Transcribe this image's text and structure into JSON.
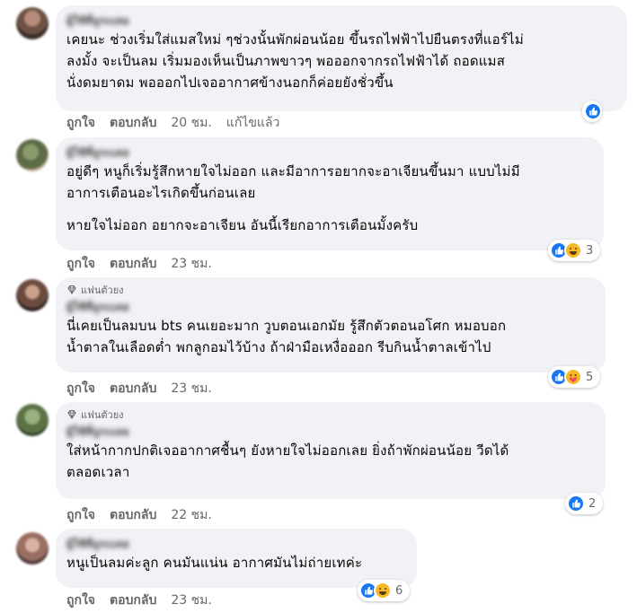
{
  "comments": [
    {
      "name": "ผู้ใช้ที่ถูกเบลอ",
      "text": "เคยนะ ช่วงเริ่มใส่แมสใหม่ ๆช่วงนั้นพักผ่อนน้อย ขึ้นรถไฟฟ้าไปยืนตรงที่แอร์ไม่\nลงมั้ง จะเป็นลม เริ่มมองเห็นเป็นภาพขาวๆ พอออกจากรถไฟฟ้าได้ ถอดแมส\nนั่งดมยาดม พอออกไปเจออากาศข้างนอกก็ค่อยยังชั่วขึ้น",
      "like_label": "ถูกใจ",
      "reply_label": "ตอบกลับ",
      "time": "20 ชม.",
      "edited": "แก้ไขแล้ว",
      "reactions": [
        "like"
      ],
      "count": ""
    },
    {
      "name": "ผู้ใช้ที่ถูกเบลอ",
      "text": "อยู่ดีๆ หนูก็เริ่มรู้สึกหายใจไม่ออก และมีอาการอยากจะอาเจียนขึ้นมา แบบไม่มี\nอาการเตือนอะไรเกิดขึ้นก่อนเลย",
      "text2": "หายใจไม่ออก อยากจะอาเจียน อันนี้เรียกอาการเตือนมั้งครับ",
      "like_label": "ถูกใจ",
      "reply_label": "ตอบกลับ",
      "time": "23 ชม.",
      "reactions": [
        "like",
        "haha"
      ],
      "count": "3"
    },
    {
      "fan_label": "แฟนตัวยง",
      "name": "ผู้ใช้ที่ถูกเบลอ",
      "text": "นี่เคยเป็นลมบน bts คนเยอะมาก วูบตอนเอกมัย รู้สึกตัวตอนอโศก หมอบอก\nน้ำตาลในเลือดต่ำ พกลูกอมไว้บ้าง ถ้าฝ่ามือเหงื่อออก รีบกินน้ำตาลเข้าไป",
      "like_label": "ถูกใจ",
      "reply_label": "ตอบกลับ",
      "time": "23 ชม.",
      "reactions": [
        "like",
        "care"
      ],
      "count": "5"
    },
    {
      "fan_label": "แฟนตัวยง",
      "name": "ผู้ใช้ที่ถูกเบลอ",
      "text": "ใส่หน้ากากปกติเจออากาศชื้นๆ ยังหายใจไม่ออกเลย ยิ่งถ้าพักผ่อนน้อย วีดได้\nตลอดเวลา",
      "like_label": "ถูกใจ",
      "reply_label": "ตอบกลับ",
      "time": "22 ชม.",
      "reactions": [
        "like"
      ],
      "count": "2"
    },
    {
      "name": "ผู้ใช้ที่ถูกเบลอ",
      "text": "หนูเป็นลมค่ะลูก คนมันแน่น อากาศมันไม่ถ่ายเทค่ะ",
      "like_label": "ถูกใจ",
      "reply_label": "ตอบกลับ",
      "time": "23 ชม.",
      "reactions": [
        "like",
        "haha"
      ],
      "count": "6"
    }
  ]
}
